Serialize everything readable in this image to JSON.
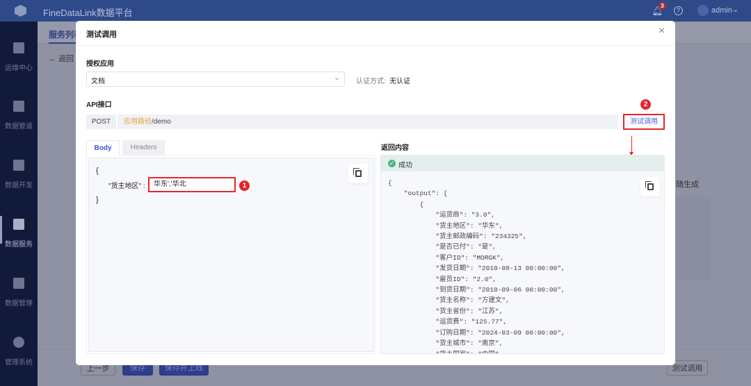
{
  "app": {
    "title": "FineDataLink数据平台",
    "notifications": "3",
    "user": "admin",
    "colors": {
      "header": "#2f4a89",
      "sidebar": "#121a3b",
      "accent": "#3d56d6",
      "highlight": "#e4252b"
    }
  },
  "sidebar": {
    "items": [
      {
        "label": "运维中心",
        "icon": "clipboard-check-icon"
      },
      {
        "label": "数据管道",
        "icon": "pipeline-icon"
      },
      {
        "label": "数据开发",
        "icon": "server-icon"
      },
      {
        "label": "数据服务",
        "icon": "service-icon",
        "active": true
      },
      {
        "label": "数据管理",
        "icon": "catalog-icon"
      },
      {
        "label": "管理系统",
        "icon": "gear-icon"
      }
    ]
  },
  "background": {
    "tab": "服务列表",
    "back": "返回",
    "generate": "随生成",
    "prev": "上一步",
    "save": "保存",
    "save_publish": "保存并上线",
    "test": "测试调用"
  },
  "modal": {
    "title": "测试调用",
    "auth_app_label": "授权应用",
    "auth_app_value": "文档",
    "auth_method_label": "认证方式:",
    "auth_method_value": "无认证",
    "api_label": "API接口",
    "method": "POST",
    "path_prefix": "应用路径",
    "path": "/demo",
    "test_button": "测试调用",
    "tabs": [
      "Body",
      "Headers"
    ],
    "body": {
      "open": "{",
      "key": "\"货主地区\" :",
      "value": "华东','华北",
      "close": "}"
    },
    "response_label": "返回内容",
    "status": "成功",
    "response_lines": [
      "{",
      "    \"output\": [",
      "        {",
      "            \"运货商\": \"3.0\",",
      "            \"货主地区\": \"华东\",",
      "            \"货主邮政编码\": \"234325\",",
      "            \"是否已付\": \"是\",",
      "            \"客户ID\": \"MORGK\",",
      "            \"发货日期\": \"2010-08-13 00:00:00\",",
      "            \"雇员ID\": \"2.0\",",
      "            \"到货日期\": \"2010-09-06 00:00:00\",",
      "            \"货主名称\": \"方建文\",",
      "            \"货主省份\": \"江苏\",",
      "            \"运货费\": \"125.77\",",
      "            \"订购日期\": \"2024-03-09 00:00:00\",",
      "            \"货主城市\": \"南京\",",
      "            \"货主国家\": \"中国\","
    ],
    "annotations": [
      "1",
      "2"
    ]
  }
}
